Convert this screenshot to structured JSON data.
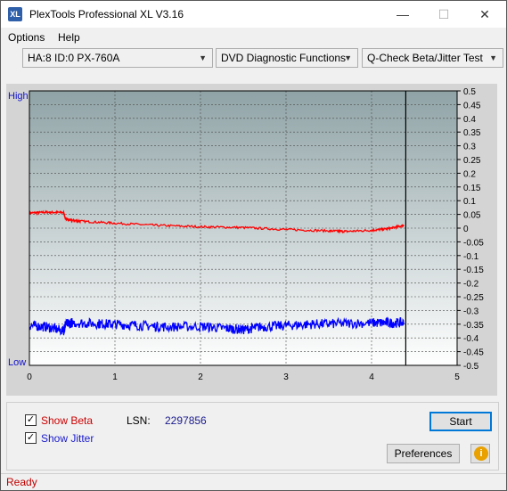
{
  "window": {
    "title": "PlexTools Professional XL V3.16",
    "app_icon_text": "XL",
    "minimize_icon": "minimize-icon",
    "maximize_icon": "maximize-icon",
    "close_icon": "close-icon"
  },
  "menu": {
    "options": "Options",
    "help": "Help"
  },
  "toolbar": {
    "drive": "HA:8 ID:0  PX-760A",
    "function": "DVD Diagnostic Functions",
    "test": "Q-Check Beta/Jitter Test"
  },
  "chart_data": {
    "type": "line",
    "left_axis": {
      "high_label": "High",
      "low_label": "Low"
    },
    "x_ticks": [
      "0",
      "1",
      "2",
      "3",
      "4",
      "5"
    ],
    "xlim": [
      0,
      5
    ],
    "y_ticks": [
      "0.5",
      "0.45",
      "0.4",
      "0.35",
      "0.3",
      "0.25",
      "0.2",
      "0.15",
      "0.1",
      "0.05",
      "0",
      "-0.05",
      "-0.1",
      "-0.15",
      "-0.2",
      "-0.25",
      "-0.3",
      "-0.35",
      "-0.4",
      "-0.45",
      "-0.5"
    ],
    "ylim": [
      -0.5,
      0.5
    ],
    "end_marker_x": 4.4,
    "grid": true,
    "series": [
      {
        "color": "#ff0000",
        "x": [
          0,
          0.2,
          0.4,
          0.42,
          0.45,
          0.6,
          1.0,
          1.5,
          2.0,
          2.5,
          3.0,
          3.5,
          3.7,
          4.0,
          4.2,
          4.38
        ],
        "y": [
          0.055,
          0.058,
          0.057,
          0.035,
          0.03,
          0.025,
          0.018,
          0.01,
          0.005,
          0.002,
          -0.005,
          -0.01,
          -0.012,
          -0.008,
          -0.002,
          0.01
        ]
      },
      {
        "color": "#0000ff",
        "x": [
          0,
          0.2,
          0.4,
          0.42,
          0.5,
          0.8,
          1.0,
          1.3,
          1.6,
          2.0,
          2.3,
          2.5,
          2.7,
          3.0,
          3.3,
          3.6,
          4.0,
          4.2,
          4.38
        ],
        "y": [
          -0.355,
          -0.36,
          -0.375,
          -0.35,
          -0.345,
          -0.348,
          -0.35,
          -0.355,
          -0.36,
          -0.358,
          -0.365,
          -0.37,
          -0.36,
          -0.355,
          -0.35,
          -0.348,
          -0.345,
          -0.345,
          -0.345
        ]
      }
    ]
  },
  "bottom_panel": {
    "show_beta_label": "Show Beta",
    "show_beta_checked": true,
    "show_beta_color": "#cc0000",
    "show_jitter_label": "Show Jitter",
    "show_jitter_checked": true,
    "show_jitter_color": "#1a1acc",
    "lsn_label": "LSN:",
    "lsn_value": "2297856",
    "start_label": "Start",
    "preferences_label": "Preferences",
    "info_icon": "info-icon"
  },
  "status": {
    "text": "Ready"
  }
}
